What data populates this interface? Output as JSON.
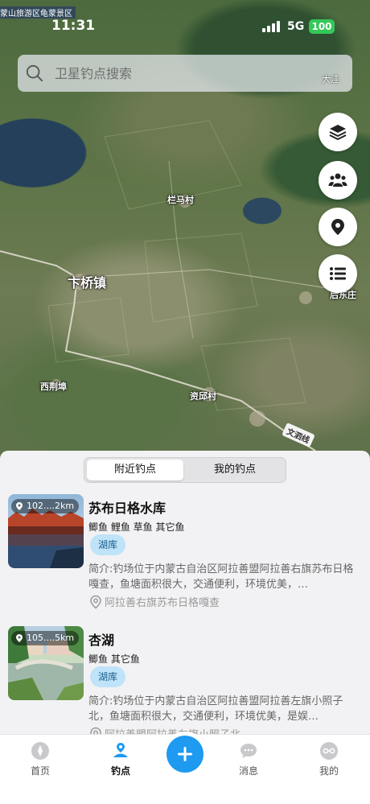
{
  "status_bar": {
    "scenic_banner": "蒙山旅游区龟蒙景区",
    "time": "11:31",
    "network": "5G",
    "battery": "100"
  },
  "search": {
    "placeholder": "卫星钓点搜索",
    "corner_label": "大洼"
  },
  "map": {
    "labels": {
      "lanmacun": "栏马村",
      "bianqiaozhen": "卞桥镇",
      "houdongzhuang": "后东庄",
      "xijingfu": "西荆埠",
      "zibucun": "资邱村",
      "road": "文泗线"
    },
    "controls": [
      "layers-icon",
      "group-icon",
      "location-pin-icon",
      "list-icon"
    ]
  },
  "tabs_segment": {
    "nearby": "附近钓点",
    "mine": "我的钓点"
  },
  "spots": [
    {
      "distance": "102....2km",
      "title": "苏布日格水库",
      "fish": "鲫鱼 鲤鱼 草鱼 其它鱼",
      "tag": "湖库",
      "description": "简介:钓场位于内蒙古自治区阿拉善盟阿拉善右旗苏布日格嘎查，鱼塘面积很大，交通便利，环境优美，…",
      "location": "阿拉善右旗苏布日格嘎查"
    },
    {
      "distance": "105....5km",
      "title": "杏湖",
      "fish": "鲫鱼 其它鱼",
      "tag": "湖库",
      "description": "简介:钓场位于内蒙古自治区阿拉善盟阿拉善左旗小照子北，鱼塘面积很大，交通便利，环境优美，是娱…",
      "location": "阿拉善盟阿拉善左旗小照子北"
    }
  ],
  "tabbar": {
    "home": "首页",
    "spots": "钓点",
    "messages": "消息",
    "me": "我的"
  },
  "colors": {
    "accent": "#1e9af1",
    "tag_bg": "#bfe3f8",
    "battery": "#34c759"
  }
}
